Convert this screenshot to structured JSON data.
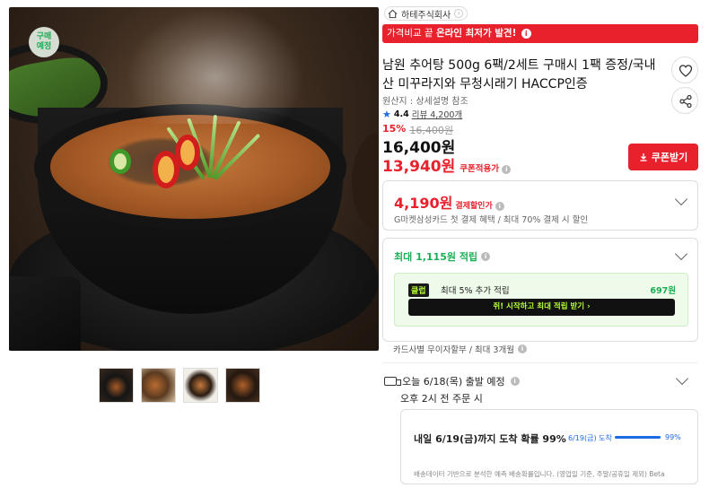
{
  "gallery": {
    "badge": "구매\n예정",
    "thumbnail_count": 4
  },
  "store": {
    "name": "하테주식회사"
  },
  "promo": {
    "prefix": "가격비교 끝 ",
    "highlight": "온라인 최저가 발견!"
  },
  "product": {
    "title": "남원 추어탕 500g 6팩/2세트 구매시 1팩 증정/국내산 미꾸라지와 무청시래기 HACCP인증",
    "origin": "원산지 : 상세설명 참조",
    "rating": "4.4",
    "review_label": "리뷰 4,200개"
  },
  "pricing": {
    "discount_pct": "15%",
    "original_price": "16,400원",
    "price": "16,400원",
    "coupon_price": "13,940원",
    "coupon_note": "쿠폰적용가",
    "coupon_button": "쿠폰받기"
  },
  "payment": {
    "amount": "4,190원",
    "label": "결제할인가",
    "desc": "G마켓삼성카드 첫 결제 혜택 / 최대 70% 결제 시 할인"
  },
  "points": {
    "title": "최대 1,115원 적립",
    "smile_badge": "클럽",
    "smile_text": "최대 5% 추가 적립",
    "smile_points": "697원",
    "smile_cta": "쥐! 시작하고 최대 적립 받기  ›"
  },
  "installment": "카드사별 무이자할부 / 최대 3개월",
  "shipping": {
    "ship_date": "오늘 6/18(목) 출발 예정",
    "cutoff": "오후 2시 전 주문 시",
    "arrival_main": "내일 6/19(금)까지 도착 확률 99%",
    "arrival_date_label": "6/19(금) 도착",
    "arrival_pct": "99%",
    "arrival_fraction": 0.99,
    "note": "배송데이터 기반으로 분석한 예측 배송확률입니다. (영업일 기준, 주말/공휴일 제외) Beta"
  },
  "colors": {
    "accent": "#e8212c",
    "points": "#1aaf55",
    "info_blue": "#1d6ae5"
  },
  "icons": [
    "home-icon",
    "info-icon",
    "heart-icon",
    "share-icon",
    "star-icon",
    "download-icon",
    "chevron-down-icon",
    "truck-icon"
  ]
}
